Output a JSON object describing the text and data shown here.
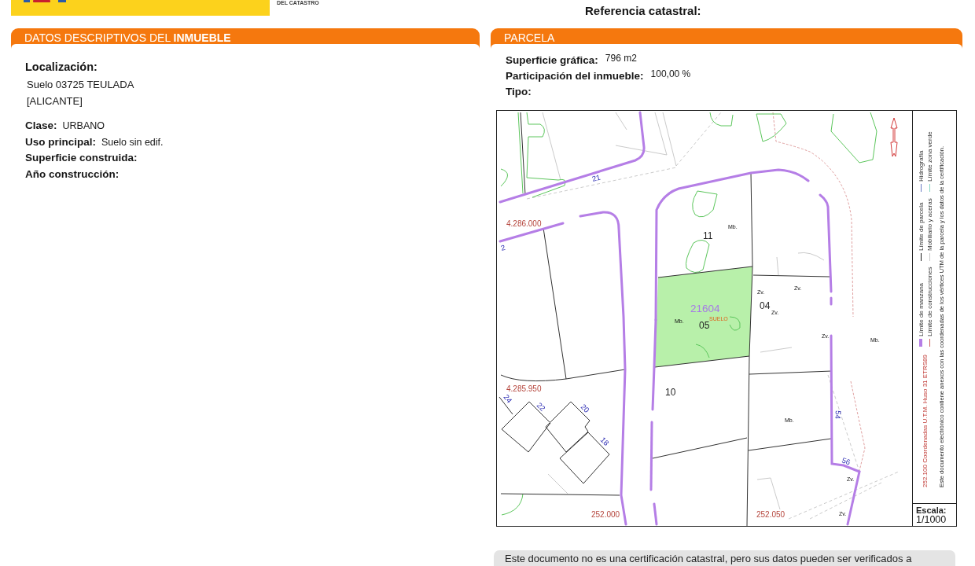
{
  "header": {
    "agency_line": "DEL CATASTRO",
    "reference_label": "Referencia catastral:"
  },
  "property_panel": {
    "title": "DATOS DESCRIPTIVOS DEL **INMUEBLE**",
    "location_label": "Localización:",
    "location_lines": [
      "Suelo 03725 TEULADA",
      "[ALICANTE]"
    ],
    "fields": [
      {
        "label": "Clase:",
        "value": "URBANO"
      },
      {
        "label": "Uso principal:",
        "value": "Suelo sin edif."
      },
      {
        "label": "Superficie construida:"
      },
      {
        "label": "Año construcción:"
      }
    ]
  },
  "parcel_panel": {
    "title": "PARCELA",
    "fields": [
      {
        "label": "Superficie gráfica:",
        "value": "796 m2"
      },
      {
        "label": "Participación del inmueble:",
        "value": "100,00 %"
      },
      {
        "label": "Tipo:"
      }
    ],
    "map": {
      "labels": [
        {
          "text": "21",
          "kind": "house_number"
        },
        {
          "text": "4.286.000",
          "kind": "coordinate"
        },
        {
          "text": "2",
          "kind": "house_number"
        },
        {
          "text": "Mb.",
          "kind": "code"
        },
        {
          "text": "11",
          "kind": "parcel"
        },
        {
          "text": "Zv.",
          "kind": "code"
        },
        {
          "text": "Zv.",
          "kind": "code"
        },
        {
          "text": "21604",
          "kind": "block"
        },
        {
          "text": "04",
          "kind": "parcel"
        },
        {
          "text": "Zv.",
          "kind": "code"
        },
        {
          "text": "SUELO",
          "kind": "land_use"
        },
        {
          "text": "Mb.",
          "kind": "code"
        },
        {
          "text": "05",
          "kind": "parcel"
        },
        {
          "text": "Zv.",
          "kind": "code"
        },
        {
          "text": "Mb.",
          "kind": "code"
        },
        {
          "text": "4.285.950",
          "kind": "coordinate"
        },
        {
          "text": "10",
          "kind": "parcel"
        },
        {
          "text": "24",
          "kind": "house_number"
        },
        {
          "text": "22",
          "kind": "house_number"
        },
        {
          "text": "20",
          "kind": "house_number"
        },
        {
          "text": "18",
          "kind": "house_number"
        },
        {
          "text": "Mb.",
          "kind": "code"
        },
        {
          "text": "54",
          "kind": "house_number"
        },
        {
          "text": "56",
          "kind": "house_number"
        },
        {
          "text": "Zv.",
          "kind": "code"
        },
        {
          "text": "252.000",
          "kind": "coordinate"
        },
        {
          "text": "252.050",
          "kind": "coordinate"
        },
        {
          "text": "Zv.",
          "kind": "code"
        }
      ],
      "legend": {
        "coordinates": "252.100 Coordenadas U.T.M. Huso 31 ETRS89",
        "rows": [
          {
            "items": [
              {
                "label": "Límite de manzana",
                "kind": "band",
                "color": "#b57ee6"
              },
              {
                "label": "Límite de parcela",
                "kind": "line",
                "color": "#1f1f1f"
              },
              {
                "label": "Hidrografía",
                "kind": "line",
                "color": "#6b7cc4"
              }
            ]
          },
          {
            "items": [
              {
                "label": "Límite de construcciones",
                "kind": "line",
                "color": "#d0605a"
              },
              {
                "label": "Mobiliario y aceras",
                "kind": "line",
                "color": "#c8c8c8"
              },
              {
                "label": "Límite zona verde",
                "kind": "line",
                "color": "#86d6c4"
              }
            ]
          }
        ],
        "note": "Este documento electrónico contiene anexos con las coordenadas de los vértices UTM de la parcela y los datos de la certificación."
      },
      "scale": {
        "label": "Escala:",
        "value": "1/1000"
      }
    }
  },
  "footer_note": "Este documento no es una certificación catastral, pero sus datos pueden ser verificados a"
}
